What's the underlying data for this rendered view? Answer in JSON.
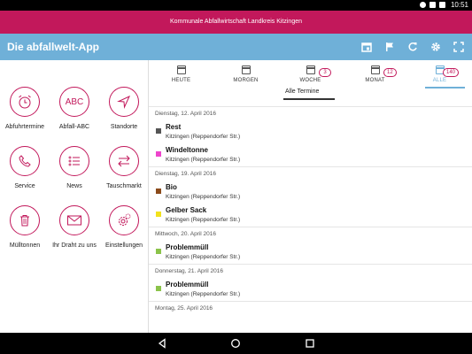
{
  "statusbar": {
    "time": "10:51"
  },
  "brand": {
    "title": "Kommunale Abfallwirtschaft Landkreis Kitzingen"
  },
  "appbar": {
    "title": "Die abfallwelt-App"
  },
  "tiles": [
    {
      "label": "Abfuhrtermine",
      "icon": "alarm-clock-icon"
    },
    {
      "label": "Abfall-ABC",
      "icon": "abc-icon",
      "glyph": "ABC"
    },
    {
      "label": "Standorte",
      "icon": "navigation-arrow-icon"
    },
    {
      "label": "Service",
      "icon": "phone-icon"
    },
    {
      "label": "News",
      "icon": "list-icon"
    },
    {
      "label": "Tauschmarkt",
      "icon": "swap-arrows-icon"
    },
    {
      "label": "Mülltonnen",
      "icon": "trash-bin-icon"
    },
    {
      "label": "Ihr Draht zu uns",
      "icon": "mail-icon"
    },
    {
      "label": "Einstellungen",
      "icon": "settings-icon"
    }
  ],
  "tabs": [
    {
      "label": "HEUTE",
      "badge": ""
    },
    {
      "label": "MORGEN",
      "badge": ""
    },
    {
      "label": "WOCHE",
      "badge": "3"
    },
    {
      "label": "MONAT",
      "badge": "12"
    },
    {
      "label": "ALLE",
      "badge": "140"
    }
  ],
  "subtab": {
    "label": "Alle Termine"
  },
  "days": [
    {
      "date": "Dienstag, 12. April 2016",
      "entries": [
        {
          "name": "Rest",
          "location": "Kitzingen (Reppendorfer Str.)",
          "color": "#555555"
        },
        {
          "name": "Windeltonne",
          "location": "Kitzingen (Reppendorfer Str.)",
          "color": "#ee44cc"
        }
      ]
    },
    {
      "date": "Dienstag, 19. April 2016",
      "entries": [
        {
          "name": "Bio",
          "location": "Kitzingen (Reppendorfer Str.)",
          "color": "#8b4a1a"
        },
        {
          "name": "Gelber Sack",
          "location": "Kitzingen (Reppendorfer Str.)",
          "color": "#f2e21c"
        }
      ]
    },
    {
      "date": "Mittwoch, 20. April 2016",
      "entries": [
        {
          "name": "Problemmüll",
          "location": "Kitzingen (Reppendorfer Str.)",
          "color": "#8bc34a"
        }
      ]
    },
    {
      "date": "Donnerstag, 21. April 2016",
      "entries": [
        {
          "name": "Problemmüll",
          "location": "Kitzingen (Reppendorfer Str.)",
          "color": "#8bc34a"
        }
      ]
    },
    {
      "date": "Montag, 25. April 2016",
      "entries": []
    }
  ],
  "colors": {
    "brand": "#c2185b",
    "appbar": "#6fb0d8"
  }
}
